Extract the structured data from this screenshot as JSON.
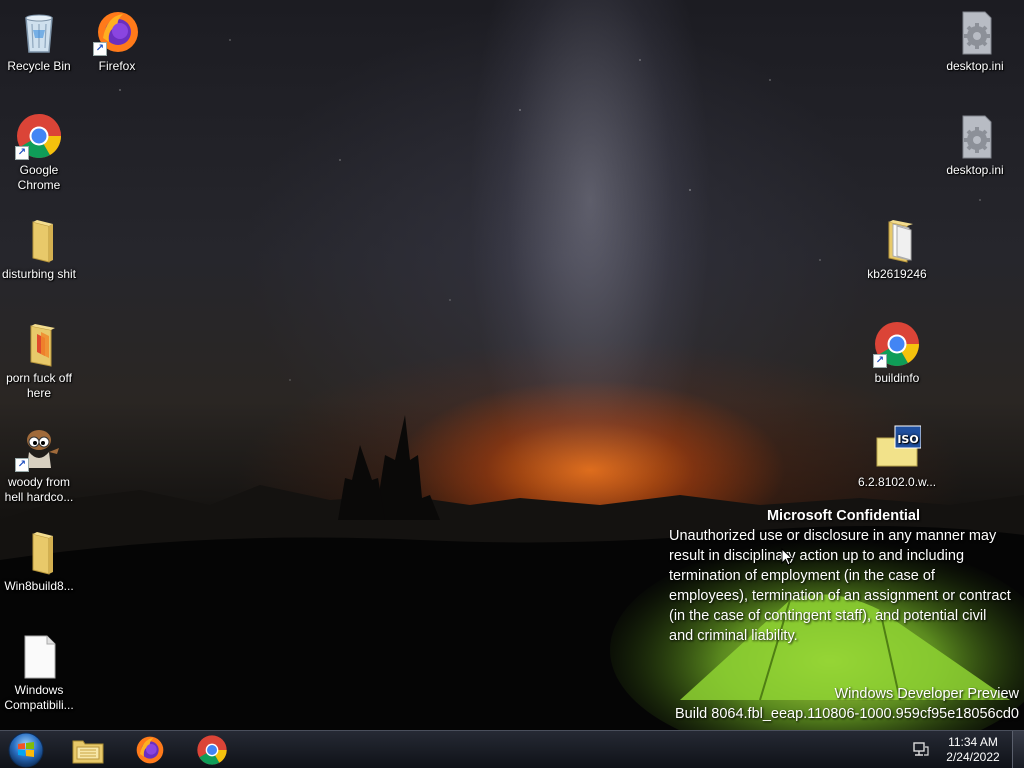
{
  "desktop": {
    "icons_left": [
      {
        "label": "Recycle Bin"
      },
      {
        "label": "Firefox"
      },
      {
        "label": "Google Chrome"
      },
      {
        "label": "disturbing shit"
      },
      {
        "label": "porn fuck off here"
      },
      {
        "label": "woody from hell hardco..."
      },
      {
        "label": "Win8build8..."
      },
      {
        "label": "Windows Compatibili..."
      }
    ],
    "icons_right": [
      {
        "label": "desktop.ini"
      },
      {
        "label": "desktop.ini"
      },
      {
        "label": "kb2619246"
      },
      {
        "label": "buildinfo"
      },
      {
        "label": "6.2.8102.0.w..."
      }
    ]
  },
  "watermark": {
    "title": "Microsoft Confidential",
    "body": "Unauthorized use or disclosure in any manner may result in disciplinary action up to and including termination of employment (in the case of employees), termination of an assignment or contract (in the case of contingent staff), and potential civil and criminal liability.",
    "product": "Windows Developer Preview",
    "build": "Build 8064.fbl_eeap.110806-1000.959cf95e18056cd0"
  },
  "taskbar": {
    "pinned": [
      {
        "icon": "file-explorer-icon"
      },
      {
        "icon": "firefox-icon"
      },
      {
        "icon": "chrome-icon"
      }
    ],
    "time": "11:34 AM",
    "date": "2/24/2022",
    "tray_icon": "network-icon"
  },
  "colors": {
    "folder": "#e8c96a",
    "chrome_red": "#db4437",
    "chrome_yellow": "#f4c20d",
    "chrome_green": "#0f9d58",
    "chrome_blue": "#4285f4",
    "tent_green": "#9fe03a"
  }
}
